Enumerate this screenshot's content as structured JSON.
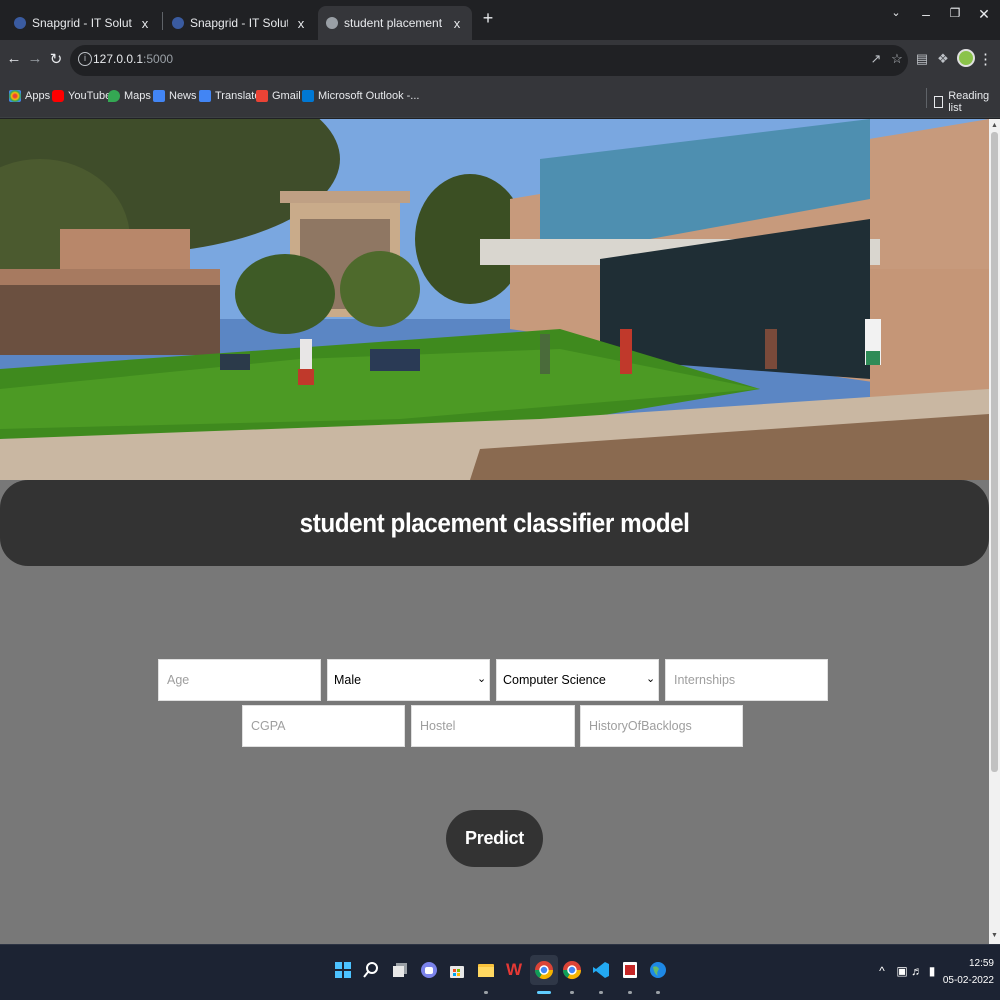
{
  "browser": {
    "tabs": [
      {
        "title": "Snapgrid - IT Solutions and Techn",
        "active": false
      },
      {
        "title": "Snapgrid - IT Solutions and Techn",
        "active": false
      },
      {
        "title": "student placement classifier mod",
        "active": true
      }
    ],
    "new_tab": "+",
    "url_host": "127.0.0.1",
    "url_port": ":5000",
    "bookmarks": [
      {
        "label": "Apps",
        "icon": "apps-grid-icon"
      },
      {
        "label": "YouTube",
        "icon": "youtube-icon"
      },
      {
        "label": "Maps",
        "icon": "maps-icon"
      },
      {
        "label": "News",
        "icon": "news-icon"
      },
      {
        "label": "Translate",
        "icon": "translate-icon"
      },
      {
        "label": "Gmail",
        "icon": "gmail-icon"
      },
      {
        "label": "Microsoft Outlook -...",
        "icon": "outlook-icon"
      }
    ],
    "reading_list": "Reading list"
  },
  "page": {
    "title": "student placement classifier model",
    "form": {
      "age_placeholder": "Age",
      "gender_selected": "Male",
      "stream_selected": "Computer Science",
      "internships_placeholder": "Internships",
      "cgpa_placeholder": "CGPA",
      "hostel_placeholder": "Hostel",
      "backlogs_placeholder": "HistoryOfBacklogs",
      "predict_label": "Predict"
    }
  },
  "taskbar": {
    "apps": [
      "windows-start-icon",
      "search-icon",
      "task-view-icon",
      "teams-chat-icon",
      "microsoft-store-icon",
      "file-explorer-icon",
      "wps-office-icon",
      "chrome-profile-icon",
      "chrome-icon",
      "vscode-icon",
      "app-icon",
      "browser-globe-icon"
    ],
    "time": "12:59",
    "date": "05-02-2022"
  },
  "colors": {
    "banner_bg": "#333333",
    "page_bg": "#787878",
    "button_bg": "#333333",
    "chrome_dark": "#202124",
    "chrome_toolbar": "#35363a"
  }
}
